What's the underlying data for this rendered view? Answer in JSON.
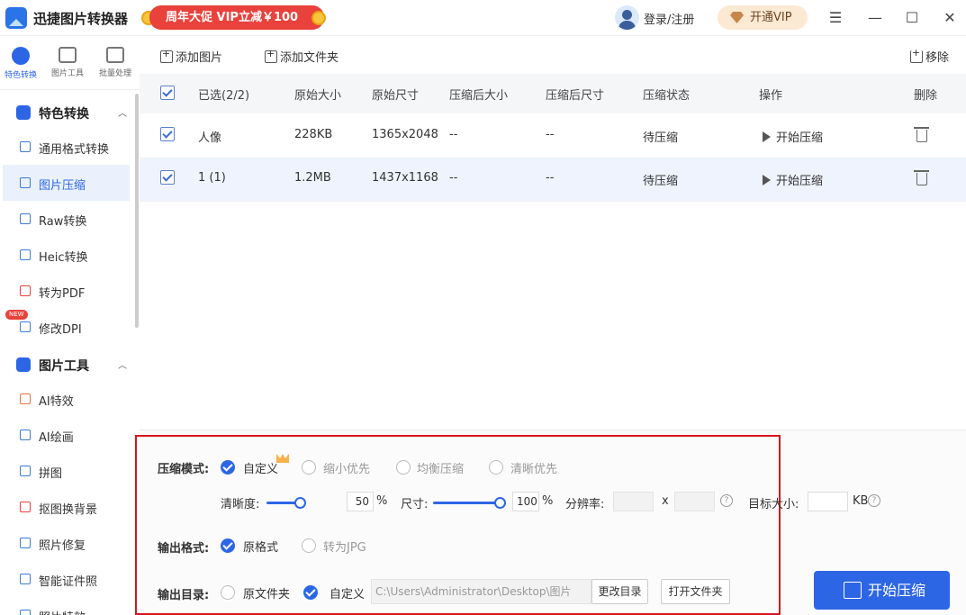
{
  "app": {
    "title": "迅捷图片转换器"
  },
  "promo": {
    "label": "周年大促 VIP立减￥100"
  },
  "header": {
    "login": "登录/注册",
    "vip": "开通VIP"
  },
  "icon_tabs": [
    {
      "label": "特色转换"
    },
    {
      "label": "图片工具"
    },
    {
      "label": "批量处理"
    }
  ],
  "sidebar": {
    "section1": "特色转换",
    "items1": [
      "通用格式转换",
      "图片压缩",
      "Raw转换",
      "Heic转换",
      "转为PDF",
      "修改DPI"
    ],
    "new_badge": "NEW",
    "section2": "图片工具",
    "items2": [
      "AI特效",
      "AI绘画",
      "拼图",
      "抠图换背景",
      "照片修复",
      "智能证件照",
      "照片特效"
    ]
  },
  "toolbar": {
    "add_image": "添加图片",
    "add_folder": "添加文件夹",
    "remove": "移除"
  },
  "table": {
    "headers": [
      "已选(2/2)",
      "原始大小",
      "原始尺寸",
      "压缩后大小",
      "压缩后尺寸",
      "压缩状态",
      "操作",
      "删除"
    ],
    "rows": [
      {
        "name": "人像",
        "size": "228KB",
        "dims": "1365x2048",
        "new_size": "--",
        "new_dims": "--",
        "status": "待压缩",
        "action": "开始压缩"
      },
      {
        "name": "1 (1)",
        "size": "1.2MB",
        "dims": "1437x1168",
        "new_size": "--",
        "new_dims": "--",
        "status": "待压缩",
        "action": "开始压缩"
      }
    ]
  },
  "settings": {
    "mode_label": "压缩模式:",
    "modes": [
      "自定义",
      "缩小优先",
      "均衡压缩",
      "清晰优先"
    ],
    "clarity_label": "清晰度:",
    "clarity_value": "50",
    "clarity_level": 0.5,
    "percent": "%",
    "size_label": "尺寸:",
    "size_value": "100",
    "size_level": 1.0,
    "resolution_label": "分辨率:",
    "x": "x",
    "target_label": "目标大小:",
    "kb": "KB",
    "format_label": "输出格式:",
    "formats": [
      "原格式",
      "转为JPG"
    ],
    "dir_label": "输出目录:",
    "dirs": [
      "原文件夹",
      "自定义"
    ],
    "dir_path": "C:\\Users\\Administrator\\Desktop\\图片",
    "change_dir": "更改目录",
    "open_folder": "打开文件夹"
  },
  "start_button": "开始压缩"
}
